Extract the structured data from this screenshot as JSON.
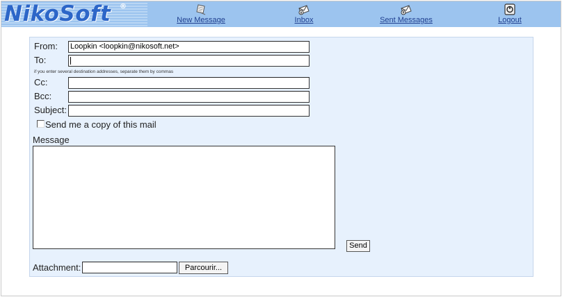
{
  "brand": {
    "name": "NikoSoft",
    "mark": "®"
  },
  "nav": {
    "new_message": {
      "label": "New Message",
      "icon": "new-message-icon"
    },
    "inbox": {
      "label": "Inbox",
      "icon": "inbox-icon"
    },
    "sent": {
      "label": "Sent Messages",
      "icon": "sent-messages-icon"
    },
    "logout": {
      "label": "Logout",
      "icon": "logout-icon"
    }
  },
  "form": {
    "from_label": "From:",
    "from_value": "Loopkin <loopkin@nikosoft.net>",
    "to_label": "To:",
    "to_value": "",
    "to_hint": "if you enter several destination addresses, separate them by commas",
    "cc_label": "Cc:",
    "bcc_label": "Bcc:",
    "subject_label": "Subject:",
    "copy_label": "Send me a copy of this mail",
    "copy_checked": false,
    "message_label": "Message",
    "send_label": "Send",
    "attachment_label": "Attachment:",
    "browse_label": "Parcourir..."
  },
  "colors": {
    "header": "#9cc4ef",
    "panel": "#e7f1fd",
    "link": "#1f3f8f",
    "logo": "#2c66c8"
  }
}
